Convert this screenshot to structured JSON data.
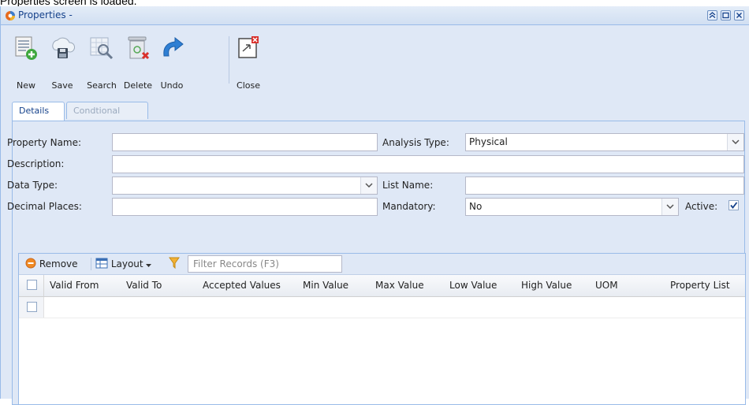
{
  "caption": "Properties screen is loaded.",
  "window": {
    "title": "Properties -"
  },
  "toolbar": {
    "items": [
      {
        "label": "New"
      },
      {
        "label": "Save"
      },
      {
        "label": "Search"
      },
      {
        "label": "Delete"
      },
      {
        "label": "Undo"
      },
      {
        "label": "Close"
      }
    ]
  },
  "tabs": [
    {
      "label": "Details"
    },
    {
      "label": "Condtional"
    }
  ],
  "form": {
    "property_name_label": "Property Name:",
    "property_name_value": "",
    "analysis_type_label": "Analysis Type:",
    "analysis_type_value": "Physical",
    "description_label": "Description:",
    "description_value": "",
    "data_type_label": "Data Type:",
    "data_type_value": "",
    "list_name_label": "List Name:",
    "list_name_value": "",
    "decimal_places_label": "Decimal Places:",
    "decimal_places_value": "",
    "mandatory_label": "Mandatory:",
    "mandatory_value": "No",
    "active_label": "Active:",
    "active_checked": true
  },
  "grid": {
    "remove_label": "Remove",
    "layout_label": "Layout",
    "filter_placeholder": "Filter Records (F3)",
    "columns": [
      "Valid From",
      "Valid To",
      "Accepted Values",
      "Min Value",
      "Max Value",
      "Low Value",
      "High Value",
      "UOM",
      "Property List"
    ]
  },
  "colors": {
    "accent": "#15428b",
    "panel_bg": "#dfe8f6",
    "border": "#99bbe8"
  }
}
